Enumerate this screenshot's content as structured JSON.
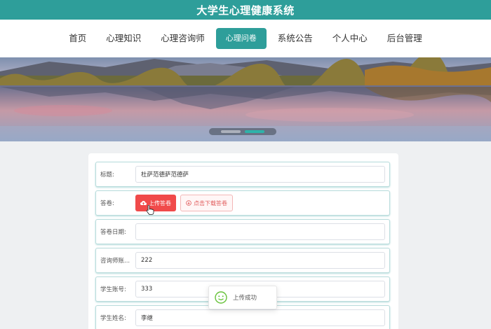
{
  "app": {
    "title": "大学生心理健康系统"
  },
  "nav": {
    "items": [
      "首页",
      "心理知识",
      "心理咨询师",
      "心理问卷",
      "系统公告",
      "个人中心",
      "后台管理"
    ],
    "active": "心理问卷"
  },
  "banner": {
    "slides": 2,
    "active_slide": 2
  },
  "form": {
    "title_label": "标题:",
    "title_value": "杜萨范德萨范德萨",
    "answer_label": "答卷:",
    "upload_label": "上传答卷",
    "download_label": "点击下载答卷",
    "date_label": "答卷日期:",
    "date_value": "",
    "counselor_label": "咨询师账...",
    "counselor_value": "222",
    "student_account_label": "学生账号:",
    "student_account_value": "333",
    "student_name_label": "学生姓名:",
    "student_name_value": "李继"
  },
  "toast": {
    "message": "上传成功"
  },
  "colors": {
    "accent": "#2e9e9a",
    "upload_button": "#f04a4a",
    "toast_icon": "#67c23a"
  },
  "icons": {
    "upload": "cloud-upload-icon",
    "download": "download-icon",
    "toast": "smiley-icon"
  }
}
